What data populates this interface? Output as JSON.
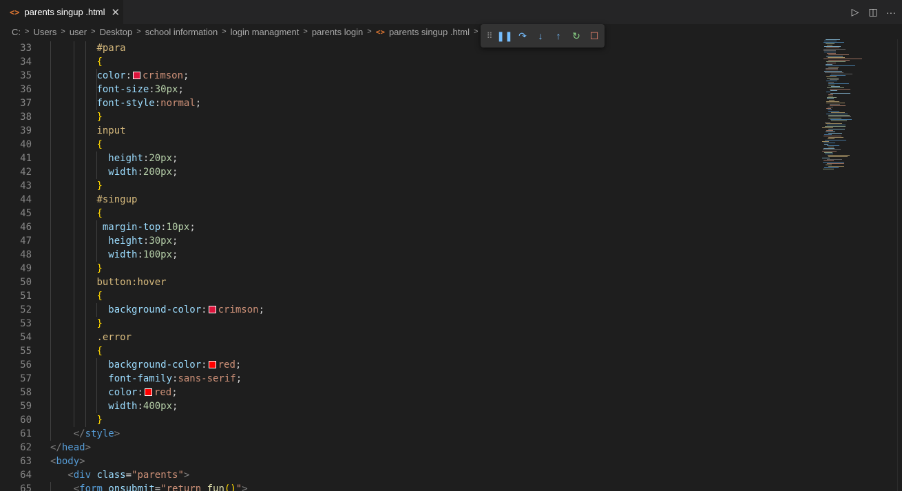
{
  "tab": {
    "icon": "html-file-icon",
    "label": "parents singup .html",
    "close_glyph": "✕"
  },
  "tab_actions": {
    "run": "▷",
    "split": "◫",
    "more": "···"
  },
  "breadcrumbs": [
    "C:",
    "Users",
    "user",
    "Desktop",
    "school information",
    "login managment",
    "parents login",
    "parents singup .html",
    "..."
  ],
  "debug_toolbar": {
    "grip": "⠿",
    "pause": "❚❚",
    "step_over": "↷",
    "step_into": "↓",
    "step_out": "↑",
    "restart": "↻",
    "stop": "☐",
    "colors": {
      "pause": "#75beff",
      "step": "#75beff",
      "restart": "#89d185",
      "stop": "#f48771"
    }
  },
  "colors": {
    "crimson": "#dc143c",
    "red": "#ff0000"
  },
  "editor": {
    "lines": [
      {
        "n": "33",
        "tokens": [
          [
            "#para",
            "sel"
          ]
        ]
      },
      {
        "n": "34",
        "tokens": [
          [
            "{",
            "brace"
          ]
        ]
      },
      {
        "n": "35",
        "tokens": [
          [
            "color",
            "prop"
          ],
          [
            ":",
            "punc"
          ],
          [
            "crimson",
            "swatch"
          ],
          [
            "crimson",
            "val"
          ],
          [
            ";",
            "punc"
          ]
        ]
      },
      {
        "n": "36",
        "tokens": [
          [
            "font-size",
            "prop"
          ],
          [
            ":",
            "punc"
          ],
          [
            "30px",
            "num"
          ],
          [
            ";",
            "punc"
          ]
        ]
      },
      {
        "n": "37",
        "tokens": [
          [
            "font-style",
            "prop"
          ],
          [
            ":",
            "punc"
          ],
          [
            "normal",
            "val"
          ],
          [
            ";",
            "punc"
          ]
        ]
      },
      {
        "n": "38",
        "tokens": [
          [
            "}",
            "brace"
          ]
        ]
      },
      {
        "n": "39",
        "tokens": [
          [
            "input",
            "sel"
          ]
        ]
      },
      {
        "n": "40",
        "tokens": [
          [
            "{",
            "brace"
          ]
        ]
      },
      {
        "n": "41",
        "tokens": [
          [
            "  height",
            "prop"
          ],
          [
            ":",
            "punc"
          ],
          [
            "20px",
            "num"
          ],
          [
            ";",
            "punc"
          ]
        ]
      },
      {
        "n": "42",
        "tokens": [
          [
            "  width",
            "prop"
          ],
          [
            ":",
            "punc"
          ],
          [
            "200px",
            "num"
          ],
          [
            ";",
            "punc"
          ]
        ]
      },
      {
        "n": "43",
        "tokens": [
          [
            "}",
            "brace"
          ]
        ]
      },
      {
        "n": "44",
        "tokens": [
          [
            "#singup",
            "sel"
          ]
        ]
      },
      {
        "n": "45",
        "tokens": [
          [
            "{",
            "brace"
          ]
        ]
      },
      {
        "n": "46",
        "tokens": [
          [
            " margin-top",
            "prop"
          ],
          [
            ":",
            "punc"
          ],
          [
            "10px",
            "num"
          ],
          [
            ";",
            "punc"
          ]
        ]
      },
      {
        "n": "47",
        "tokens": [
          [
            "  height",
            "prop"
          ],
          [
            ":",
            "punc"
          ],
          [
            "30px",
            "num"
          ],
          [
            ";",
            "punc"
          ]
        ]
      },
      {
        "n": "48",
        "tokens": [
          [
            "  width",
            "prop"
          ],
          [
            ":",
            "punc"
          ],
          [
            "100px",
            "num"
          ],
          [
            ";",
            "punc"
          ]
        ]
      },
      {
        "n": "49",
        "tokens": [
          [
            "}",
            "brace"
          ]
        ]
      },
      {
        "n": "50",
        "tokens": [
          [
            "button:hover",
            "sel"
          ]
        ]
      },
      {
        "n": "51",
        "tokens": [
          [
            "{",
            "brace"
          ]
        ]
      },
      {
        "n": "52",
        "tokens": [
          [
            "  background-color",
            "prop"
          ],
          [
            ":",
            "punc"
          ],
          [
            "crimson",
            "swatch"
          ],
          [
            "crimson",
            "val"
          ],
          [
            ";",
            "punc"
          ]
        ]
      },
      {
        "n": "53",
        "tokens": [
          [
            "}",
            "brace"
          ]
        ]
      },
      {
        "n": "54",
        "tokens": [
          [
            ".error",
            "sel"
          ]
        ]
      },
      {
        "n": "55",
        "tokens": [
          [
            "{",
            "brace"
          ]
        ]
      },
      {
        "n": "56",
        "tokens": [
          [
            "  background-color",
            "prop"
          ],
          [
            ":",
            "punc"
          ],
          [
            "red",
            "swatch"
          ],
          [
            "red",
            "val"
          ],
          [
            ";",
            "punc"
          ]
        ]
      },
      {
        "n": "57",
        "tokens": [
          [
            "  font-family",
            "prop"
          ],
          [
            ":",
            "punc"
          ],
          [
            "sans-serif",
            "val"
          ],
          [
            ";",
            "punc"
          ]
        ]
      },
      {
        "n": "58",
        "tokens": [
          [
            "  color",
            "prop"
          ],
          [
            ":",
            "punc"
          ],
          [
            "red",
            "swatch"
          ],
          [
            "red",
            "val"
          ],
          [
            ";",
            "punc"
          ]
        ]
      },
      {
        "n": "59",
        "tokens": [
          [
            "  width",
            "prop"
          ],
          [
            ":",
            "punc"
          ],
          [
            "400px",
            "num"
          ],
          [
            ";",
            "punc"
          ]
        ]
      },
      {
        "n": "60",
        "tokens": [
          [
            "}",
            "brace"
          ]
        ]
      },
      {
        "n": "61",
        "tokens": [
          [
            "</",
            "tagb"
          ],
          [
            "style",
            "tag"
          ],
          [
            ">",
            "tagb"
          ]
        ]
      },
      {
        "n": "62",
        "tokens": [
          [
            "</",
            "tagb"
          ],
          [
            "head",
            "tag"
          ],
          [
            ">",
            "tagb"
          ]
        ]
      },
      {
        "n": "63",
        "tokens": [
          [
            "<",
            "tagb"
          ],
          [
            "body",
            "tag"
          ],
          [
            ">",
            "tagb"
          ]
        ]
      },
      {
        "n": "64",
        "tokens": [
          [
            "<",
            "tagb"
          ],
          [
            "div",
            "tag"
          ],
          [
            " ",
            "punc"
          ],
          [
            "class",
            "attr"
          ],
          [
            "=",
            "punc"
          ],
          [
            "\"parents\"",
            "str"
          ],
          [
            ">",
            "tagb"
          ]
        ]
      },
      {
        "n": "65",
        "tokens": [
          [
            "<",
            "tagb"
          ],
          [
            "form",
            "tag"
          ],
          [
            " ",
            "punc"
          ],
          [
            "onsubmit",
            "attr"
          ],
          [
            "=",
            "punc"
          ],
          [
            "\"return ",
            "str"
          ],
          [
            "fun",
            "fn"
          ],
          [
            "()",
            "brace"
          ],
          [
            "\"",
            "str"
          ],
          [
            ">",
            "tagb"
          ]
        ]
      }
    ]
  }
}
